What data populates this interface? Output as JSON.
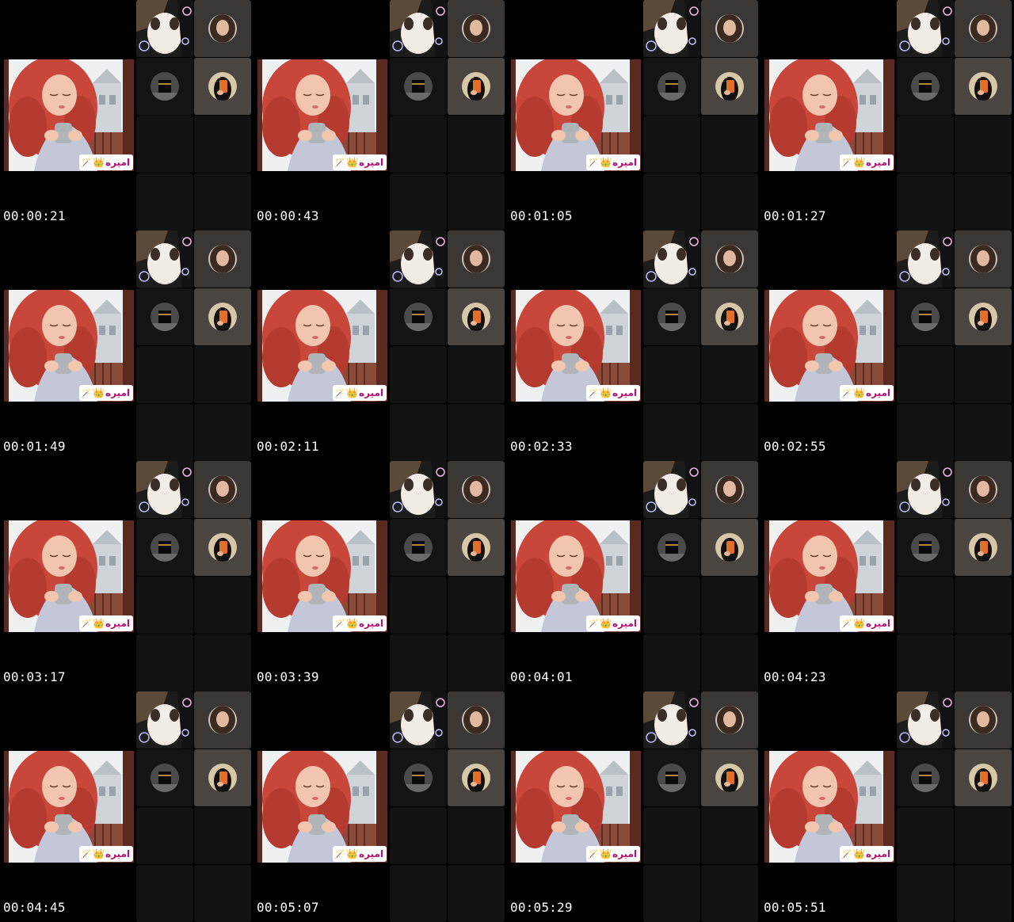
{
  "call": {
    "host_name": "اميره",
    "host_name_emojis": [
      "👑",
      "🪄"
    ],
    "participants": [
      {
        "id": "cat-bubbles",
        "icon": "cat-with-bubbles-icon"
      },
      {
        "id": "curly-hair-woman",
        "icon": "woman-avatar-icon"
      },
      {
        "id": "kaaba",
        "icon": "kaaba-avatar-icon"
      },
      {
        "id": "mirror-selfie",
        "icon": "selfie-avatar-icon"
      }
    ]
  },
  "frames": [
    {
      "timestamp": "00:00:21"
    },
    {
      "timestamp": "00:00:43"
    },
    {
      "timestamp": "00:01:05"
    },
    {
      "timestamp": "00:01:27"
    },
    {
      "timestamp": "00:01:49"
    },
    {
      "timestamp": "00:02:11"
    },
    {
      "timestamp": "00:02:33"
    },
    {
      "timestamp": "00:02:55"
    },
    {
      "timestamp": "00:03:17"
    },
    {
      "timestamp": "00:03:39"
    },
    {
      "timestamp": "00:04:01"
    },
    {
      "timestamp": "00:04:23"
    },
    {
      "timestamp": "00:04:45"
    },
    {
      "timestamp": "00:05:07"
    },
    {
      "timestamp": "00:05:29"
    },
    {
      "timestamp": "00:05:51"
    }
  ],
  "colors": {
    "background": "#000000",
    "tile_dark": "#141414",
    "tile_grey": "#3a3734",
    "name_tag_text": "#b0126f",
    "hair": "#c8463a"
  }
}
